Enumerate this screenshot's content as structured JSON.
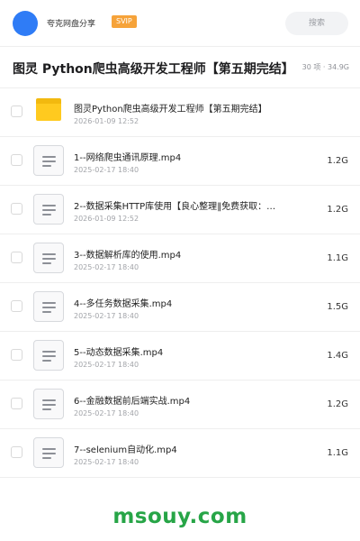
{
  "header": {
    "username": "夸克网盘分享",
    "badge": "SVIP",
    "search_placeholder": "搜索",
    "avatar_color": "#2f7cf6"
  },
  "title_bar": {
    "title": "图灵 Python爬虫高级开发工程师【第五期完结】",
    "summary": "30 项 · 34.9G"
  },
  "files": [
    {
      "type": "folder",
      "name": "图灵Python爬虫高级开发工程师【第五期完结】",
      "date": "2026-01-09 12:52",
      "size": ""
    },
    {
      "type": "doc",
      "name": "1--网络爬虫通讯原理.mp4",
      "date": "2025-02-17 18:40",
      "size": "1.2G"
    },
    {
      "type": "doc",
      "name": "2--数据采集HTTP库使用【良心整理‖免费获取：…",
      "date": "2026-01-09 12:52",
      "size": "1.2G"
    },
    {
      "type": "doc",
      "name": "3--数据解析库的使用.mp4",
      "date": "2025-02-17 18:40",
      "size": "1.1G"
    },
    {
      "type": "doc",
      "name": "4--多任务数据采集.mp4",
      "date": "2025-02-17 18:40",
      "size": "1.5G"
    },
    {
      "type": "doc",
      "name": "5--动态数据采集.mp4",
      "date": "2025-02-17 18:40",
      "size": "1.4G"
    },
    {
      "type": "doc",
      "name": "6--金融数据前后端实战.mp4",
      "date": "2025-02-17 18:40",
      "size": "1.2G"
    },
    {
      "type": "doc",
      "name": "7--selenium自动化.mp4",
      "date": "2025-02-17 18:40",
      "size": "1.1G"
    }
  ],
  "watermark": "msouy.com",
  "colors": {
    "badge": "#f6a33a",
    "folder": "#ffca1f",
    "watermark": "#27a547"
  }
}
